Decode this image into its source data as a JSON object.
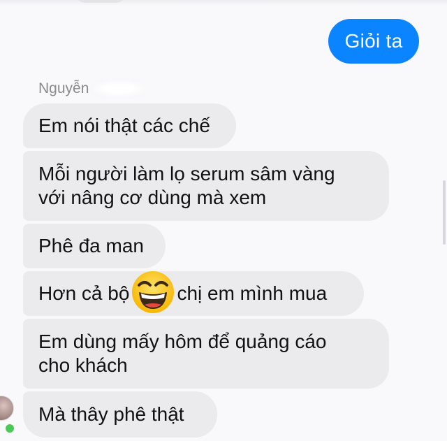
{
  "conversation": {
    "outgoing_message": "Giỏi ta",
    "sender_name": "Nguyễn",
    "messages": [
      "Em nói thật các chế",
      [
        "Mỗi người làm lọ serum sâm vàng",
        "với nâng cơ dùng mà xem"
      ],
      "Phê đa man",
      {
        "before_emoji": "Hơn cả bộ",
        "emoji": "grinning-squinting-face-icon",
        "after_emoji": "chị em mình mua"
      },
      [
        "Em dùng mấy hôm để quảng cáo",
        "cho khách"
      ],
      "Mà thây phê thật"
    ]
  },
  "colors": {
    "outgoing_bubble": "#0b84ff",
    "incoming_bubble": "#ebebee",
    "background": "#f9f9fb",
    "online_indicator": "#4ac959"
  }
}
